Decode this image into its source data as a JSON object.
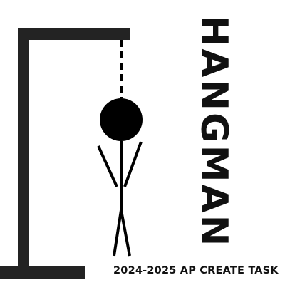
{
  "game": {
    "title": "HANGMAN",
    "subtitle": "2024-2025 AP CREATE TASK"
  },
  "colors": {
    "gallows": "#232323",
    "figure": "#000000",
    "background": "#ffffff",
    "text": "#111111"
  },
  "figure": {
    "parts_shown": [
      "head",
      "left-arm",
      "right-arm",
      "body",
      "left-leg",
      "right-leg"
    ],
    "rope_style": "dashed"
  }
}
